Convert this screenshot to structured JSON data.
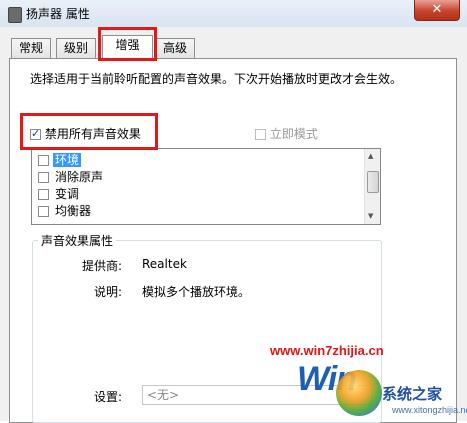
{
  "window": {
    "title": "扬声器 属性",
    "close_label": "✕"
  },
  "tabs": [
    {
      "label": "常规",
      "active": false
    },
    {
      "label": "级别",
      "active": false
    },
    {
      "label": "增强",
      "active": true
    },
    {
      "label": "高级",
      "active": false
    }
  ],
  "description": "选择适用于当前聆听配置的声音效果。下次开始播放时更改才会生效。",
  "disable_all": {
    "label": "禁用所有声音效果",
    "checked": true
  },
  "immediate_mode": {
    "label": "立即模式",
    "checked": false,
    "enabled": false
  },
  "effects": [
    {
      "label": "环境",
      "checked": false,
      "selected": true
    },
    {
      "label": "消除原声",
      "checked": false,
      "selected": false
    },
    {
      "label": "变调",
      "checked": false,
      "selected": false
    },
    {
      "label": "均衡器",
      "checked": false,
      "selected": false
    }
  ],
  "properties": {
    "group_title": "声音效果属性",
    "provider_label": "提供商:",
    "provider_value": "Realtek",
    "description_label": "说明:",
    "description_value": "模拟多个播放环境。",
    "settings_label": "设置:",
    "settings_value": "<无>"
  },
  "watermark": {
    "url": "www.win7zhijia.cn",
    "logo_text": "Win",
    "site_name": "系统之家",
    "site_url": "www.xitongzhijia.net"
  },
  "colors": {
    "highlight_red": "#e01919",
    "selection_blue": "#3399ff"
  }
}
